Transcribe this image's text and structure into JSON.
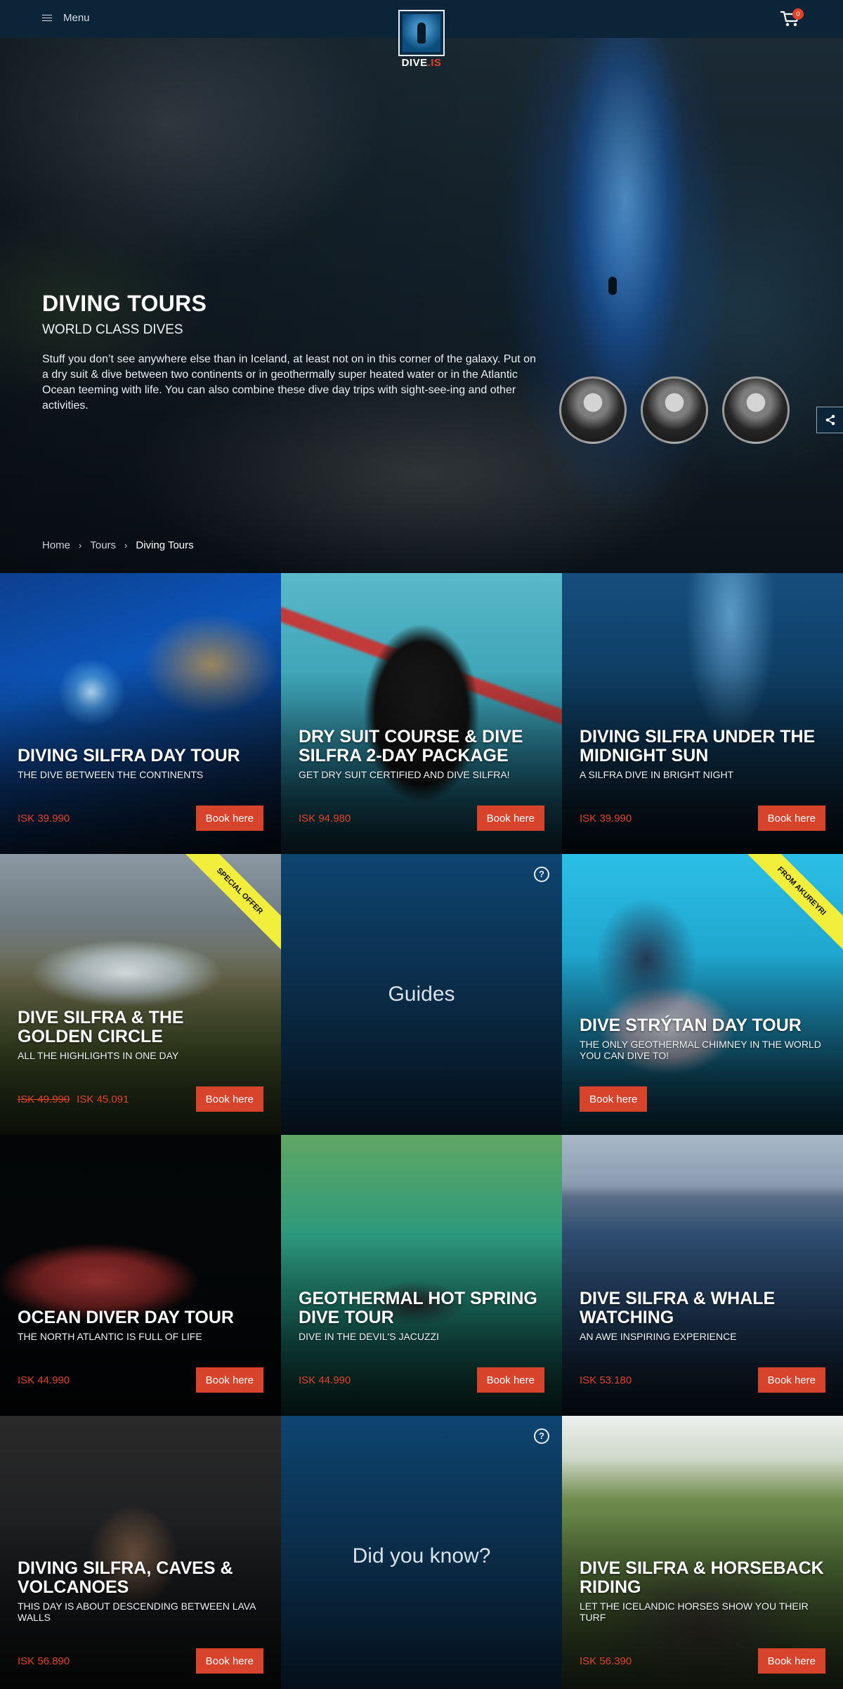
{
  "nav": {
    "menu_label": "Menu",
    "cart_count": "0",
    "logo_text_a": "DIVE",
    "logo_text_b": ".IS"
  },
  "hero": {
    "title": "DIVING TOURS",
    "subtitle": "WORLD CLASS DIVES",
    "description": "Stuff you don’t see anywhere else than in Iceland, at least not on in this corner of the galaxy. Put on a dry suit & dive between two continents or in geothermally super heated water or in the Atlantic Ocean teeming with life. You can also combine these dive day trips with sight-see-ing and other activities.",
    "guides_count": 3
  },
  "breadcrumb": [
    "Home",
    "Tours",
    "Diving Tours"
  ],
  "colors": {
    "accent": "#d8432c",
    "navbar": "#0c2437",
    "ribbon": "#f1ee3c"
  },
  "tiles": [
    {
      "title": "DIVING SILFRA DAY TOUR",
      "subtitle": "THE DIVE BETWEEN THE CONTINENTS",
      "price": "ISK 39.990",
      "button": "Book here"
    },
    {
      "title": "DRY SUIT COURSE & DIVE SILFRA 2-DAY PACKAGE",
      "subtitle": "GET DRY SUIT CERTIFIED AND DIVE SILFRA!",
      "price": "ISK 94.980",
      "button": "Book here"
    },
    {
      "title": "DIVING SILFRA UNDER THE MIDNIGHT SUN",
      "subtitle": "A SILFRA DIVE IN BRIGHT NIGHT",
      "price": "ISK 39.990",
      "button": "Book here"
    },
    {
      "title": "DIVE SILFRA & THE GOLDEN CIRCLE",
      "subtitle": "ALL THE HIGHLIGHTS IN ONE DAY",
      "price_old": "ISK 49.990",
      "price": "ISK 45.091",
      "button": "Book here",
      "ribbon": "SPECIAL OFFER"
    },
    {
      "info": "Guides"
    },
    {
      "title": "DIVE STRÝTAN DAY TOUR",
      "subtitle": "THE ONLY GEOTHERMAL CHIMNEY IN THE WORLD YOU CAN DIVE TO!",
      "button": "Book here",
      "ribbon": "FROM AKUREYRI"
    },
    {
      "title": "OCEAN DIVER DAY TOUR",
      "subtitle": "THE NORTH ATLANTIC IS FULL OF LIFE",
      "price": "ISK 44.990",
      "button": "Book here"
    },
    {
      "title": "GEOTHERMAL HOT SPRING DIVE TOUR",
      "subtitle": "DIVE IN THE DEVIL'S JACUZZI",
      "price": "ISK 44.990",
      "button": "Book here"
    },
    {
      "title": "DIVE SILFRA & WHALE WATCHING",
      "subtitle": "AN AWE INSPIRING EXPERIENCE",
      "price": "ISK 53.180",
      "button": "Book here"
    },
    {
      "title": "DIVING SILFRA, CAVES & VOLCANOES",
      "subtitle": "THIS DAY IS ABOUT DESCENDING BETWEEN LAVA WALLS",
      "price": "ISK 56.890",
      "button": "Book here"
    },
    {
      "info": "Did you know?"
    },
    {
      "title": "DIVE SILFRA & HORSEBACK RIDING",
      "subtitle": "LET THE ICELANDIC HORSES SHOW YOU THEIR TURF",
      "price": "ISK 56.390",
      "button": "Book here"
    }
  ]
}
